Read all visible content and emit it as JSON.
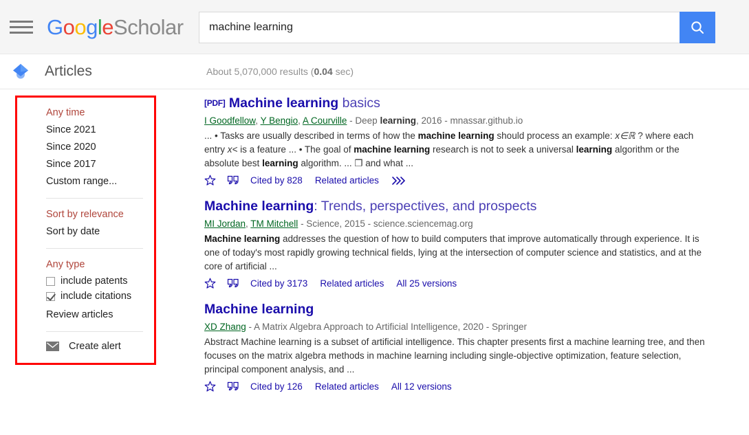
{
  "header": {
    "menu_icon": "hamburger-menu-icon",
    "logo": {
      "g1": "G",
      "o1": "o",
      "o2": "o",
      "g2": "g",
      "l1": "l",
      "e1": "e",
      "scholar": "Scholar"
    },
    "search": {
      "value": "machine learning",
      "placeholder": "",
      "button_icon": "search-icon"
    }
  },
  "subheader": {
    "section_icon": "graduation-cap-icon",
    "section_label": "Articles",
    "results_prefix": "About 5,070,000 results (",
    "results_time": "0.04",
    "results_suffix": " sec)"
  },
  "sidebar": {
    "time_filters": [
      {
        "label": "Any time",
        "selected": true
      },
      {
        "label": "Since 2021",
        "selected": false
      },
      {
        "label": "Since 2020",
        "selected": false
      },
      {
        "label": "Since 2017",
        "selected": false
      },
      {
        "label": "Custom range...",
        "selected": false
      }
    ],
    "sort_filters": [
      {
        "label": "Sort by relevance",
        "selected": true
      },
      {
        "label": "Sort by date",
        "selected": false
      }
    ],
    "type_header": {
      "label": "Any type",
      "selected": true
    },
    "checkboxes": [
      {
        "label": "include patents",
        "checked": false
      },
      {
        "label": "include citations",
        "checked": true
      }
    ],
    "review_articles": "Review articles",
    "create_alert": {
      "label": "Create alert",
      "icon": "envelope-icon"
    },
    "highlight_color": "#ff0000",
    "selected_color": "#b0463c"
  },
  "results": [
    {
      "tag": "[PDF]",
      "title_bold": "Machine learning",
      "title_rest": " basics",
      "authors": [
        "I Goodfellow",
        "Y Bengio",
        "A Courville"
      ],
      "source_pre": " - Deep ",
      "source_bold": "learning",
      "source_post": ", 2016 - mnassar.github.io",
      "snippet_parts": [
        {
          "t": "... • Tasks are usually described in terms of how the ",
          "b": false
        },
        {
          "t": "machine learning",
          "b": true
        },
        {
          "t": " should process an example: ",
          "b": false
        },
        {
          "t": "x∈ℝ",
          "b": false,
          "i": true
        },
        {
          "t": " ? where each entry ",
          "b": false
        },
        {
          "t": "x<",
          "b": false,
          "i": true
        },
        {
          "t": " is a feature ... • The goal of ",
          "b": false
        },
        {
          "t": "machine learning",
          "b": true
        },
        {
          "t": " research is not to seek a universal ",
          "b": false
        },
        {
          "t": "learning",
          "b": true
        },
        {
          "t": " algorithm or the absolute best ",
          "b": false
        },
        {
          "t": "learning",
          "b": true
        },
        {
          "t": " algorithm. ... ❐ and what ...",
          "b": false
        }
      ],
      "links": {
        "star_icon": "star-icon",
        "quote_icon": "quote-icon",
        "cited_by": "Cited by 828",
        "related": "Related articles",
        "versions": null,
        "more_icon": "double-chevron-icon"
      }
    },
    {
      "tag": "",
      "title_bold": "Machine learning",
      "title_rest": ": Trends, perspectives, and prospects",
      "authors": [
        "MI Jordan",
        "TM Mitchell"
      ],
      "source_pre": " - Science, 2015 - science.sciencemag.org",
      "source_bold": "",
      "source_post": "",
      "snippet_parts": [
        {
          "t": "Machine learning",
          "b": true
        },
        {
          "t": " addresses the question of how to build computers that improve automatically through experience. It is one of today's most rapidly growing technical fields, lying at the intersection of computer science and statistics, and at the core of artificial ...",
          "b": false
        }
      ],
      "links": {
        "star_icon": "star-icon",
        "quote_icon": "quote-icon",
        "cited_by": "Cited by 3173",
        "related": "Related articles",
        "versions": "All 25 versions",
        "more_icon": null
      }
    },
    {
      "tag": "",
      "title_bold": "Machine learning",
      "title_rest": "",
      "authors": [
        "XD Zhang"
      ],
      "source_pre": " - A Matrix Algebra Approach to Artificial Intelligence, 2020 - Springer",
      "source_bold": "",
      "source_post": "",
      "snippet_parts": [
        {
          "t": "Abstract Machine learning is a subset of artificial intelligence. This chapter presents first a machine learning tree, and then focuses on the matrix algebra methods in machine learning including single-objective optimization, feature selection, principal component analysis, and ...",
          "b": false
        }
      ],
      "links": {
        "star_icon": "star-icon",
        "quote_icon": "quote-icon",
        "cited_by": "Cited by 126",
        "related": "Related articles",
        "versions": "All 12 versions",
        "more_icon": null
      }
    }
  ]
}
